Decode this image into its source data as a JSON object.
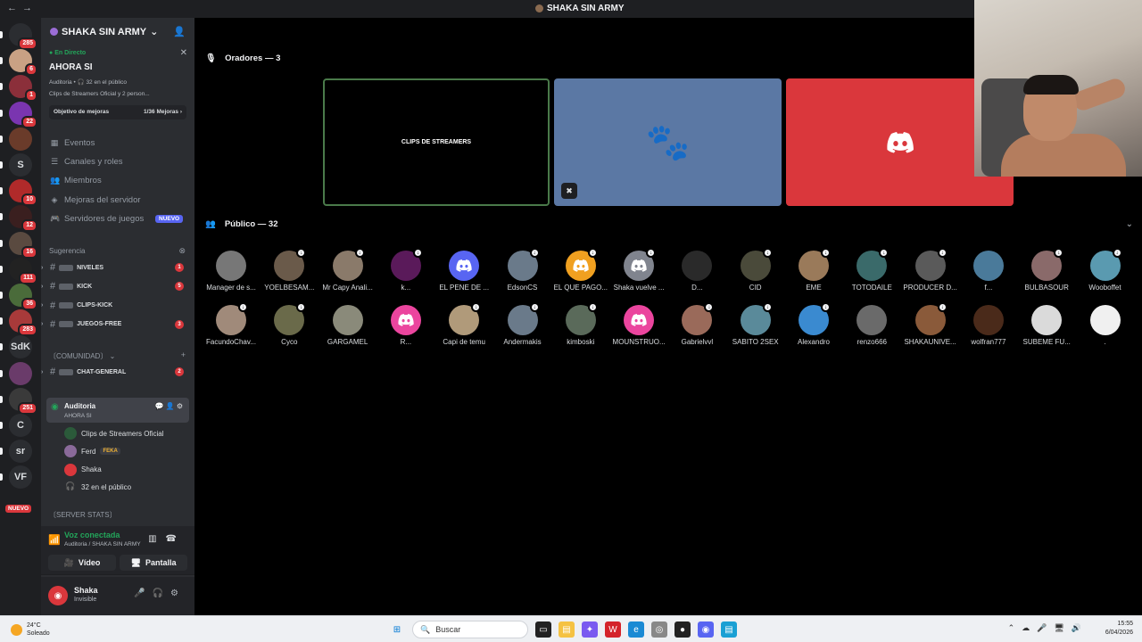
{
  "window": {
    "title": "SHAKA SIN ARMY"
  },
  "guilds": [
    {
      "label": "",
      "badge": "285",
      "color": "#2b2d31",
      "glyph": "◆"
    },
    {
      "label": "",
      "badge": "6",
      "color": "#c9a184",
      "glyph": ""
    },
    {
      "label": "",
      "badge": "1",
      "color": "#8b2f3a",
      "glyph": ""
    },
    {
      "label": "",
      "badge": "22",
      "color": "#7a35b0",
      "glyph": ""
    },
    {
      "label": "",
      "badge": "",
      "color": "#6a3b2a",
      "glyph": ""
    },
    {
      "label": "S",
      "badge": "",
      "color": "#2b2d31",
      "glyph": ""
    },
    {
      "label": "",
      "badge": "10",
      "color": "#b02a2a",
      "glyph": ""
    },
    {
      "label": "",
      "badge": "12",
      "color": "#3a1f1f",
      "glyph": ""
    },
    {
      "label": "",
      "badge": "16",
      "color": "#5a4a40",
      "glyph": ""
    },
    {
      "label": "",
      "badge": "111",
      "color": "#222",
      "glyph": ""
    },
    {
      "label": "",
      "badge": "36",
      "color": "#4a6b3a",
      "glyph": ""
    },
    {
      "label": "",
      "badge": "283",
      "color": "#a83a3a",
      "glyph": ""
    },
    {
      "label": "SdK",
      "badge": "",
      "color": "#2b2d31",
      "glyph": ""
    },
    {
      "label": "",
      "badge": "",
      "color": "#6a3b6a",
      "glyph": ""
    },
    {
      "label": "",
      "badge": "251",
      "color": "#3a3a3a",
      "glyph": ""
    },
    {
      "label": "C",
      "badge": "",
      "color": "#2b2d31",
      "glyph": ""
    },
    {
      "label": "sr",
      "badge": "",
      "color": "#2b2d31",
      "glyph": ""
    },
    {
      "label": "VF",
      "badge": "",
      "color": "#2b2d31",
      "glyph": ""
    }
  ],
  "guild_new_label": "NUEVO",
  "server": {
    "name": "SHAKA SIN ARMY"
  },
  "live": {
    "tag": "En Directo",
    "title": "AHORA SI",
    "meta": "Auditoria • 🎧 32 en el público",
    "who": "Clips de Streamers Oficial y 2 person...",
    "goal_label": "Objetivo de mejoras",
    "goal_value": "1/36 Mejoras ›"
  },
  "menu": [
    {
      "label": "Eventos",
      "icon": "calendar-icon",
      "glyph": "▦"
    },
    {
      "label": "Canales y roles",
      "icon": "channels-icon",
      "glyph": "☰"
    },
    {
      "label": "Miembros",
      "icon": "members-icon",
      "glyph": "👥"
    },
    {
      "label": "Mejoras del servidor",
      "icon": "boost-icon",
      "glyph": "◈"
    },
    {
      "label": "Servidores de juegos",
      "icon": "gamepad-icon",
      "glyph": "🎮"
    }
  ],
  "menu_new_badge": "NUEVO",
  "categories": {
    "sugerencia": "Sugerencia",
    "comunidad": "〔COMUNIDAD〕",
    "server_stats": "〔SERVER STATS〕"
  },
  "channels": [
    {
      "label": "NIVELES",
      "count": "1"
    },
    {
      "label": "KICK",
      "count": "5"
    },
    {
      "label": "CLIPS-KICK",
      "count": ""
    },
    {
      "label": "JUEGOS-FREE",
      "count": "3"
    }
  ],
  "community_channel": {
    "label": "CHAT-GENERAL",
    "count": "2"
  },
  "voice_channel": {
    "name": "Auditoria",
    "sub": "AHORA SI"
  },
  "voice_users": [
    {
      "name": "Clips de Streamers Oficial",
      "color": "#2b5a3a",
      "tag": ""
    },
    {
      "name": "Ferd",
      "color": "#8a6a9a",
      "tag": "FEKA"
    },
    {
      "name": "Shaka",
      "color": "#da373c",
      "tag": ""
    },
    {
      "name": "32 en el público",
      "color": "transparent",
      "tag": ""
    }
  ],
  "voice_panel": {
    "status": "Voz conectada",
    "sub": "Auditoria / SHAKA SIN ARMY",
    "video": "Vídeo",
    "screen": "Pantalla"
  },
  "user": {
    "name": "Shaka",
    "status": "Invisible"
  },
  "stage": {
    "speakers_title": "Oradores — 3",
    "audience_title": "Público — 32",
    "tile1_label": "CLIPS DE STREAMERS"
  },
  "audience": [
    {
      "name": "Manager de s...",
      "color": "#777",
      "dl": false,
      "glyph": ""
    },
    {
      "name": "YOELBESAM...",
      "color": "#6a5a4a",
      "dl": true,
      "glyph": ""
    },
    {
      "name": "Mr Capy Anali...",
      "color": "#8a7a6a",
      "dl": true,
      "glyph": ""
    },
    {
      "name": "k...",
      "color": "#5a1a5a",
      "dl": true,
      "glyph": ""
    },
    {
      "name": "EL PENE DE ...",
      "color": "#5865f2",
      "dl": false,
      "glyph": "discord"
    },
    {
      "name": "EdsonCS",
      "color": "#6a7a8a",
      "dl": true,
      "glyph": ""
    },
    {
      "name": "EL QUE PAGO...",
      "color": "#f0a020",
      "dl": true,
      "glyph": "discord"
    },
    {
      "name": "Shaka vuelve ...",
      "color": "#80848e",
      "dl": true,
      "glyph": "discord"
    },
    {
      "name": "D...",
      "color": "#2a2a2a",
      "dl": false,
      "glyph": ""
    },
    {
      "name": "CID",
      "color": "#4a4a3a",
      "dl": true,
      "glyph": ""
    },
    {
      "name": "EME",
      "color": "#9a7a5a",
      "dl": true,
      "glyph": ""
    },
    {
      "name": "TOTODAILE",
      "color": "#3a6a6a",
      "dl": true,
      "glyph": ""
    },
    {
      "name": "PRODUCER D...",
      "color": "#5a5a5a",
      "dl": true,
      "glyph": ""
    },
    {
      "name": "f...",
      "color": "#4a7a9a",
      "dl": false,
      "glyph": ""
    },
    {
      "name": "BULBASOUR",
      "color": "#8a6a6a",
      "dl": true,
      "glyph": ""
    },
    {
      "name": "Wooboffet",
      "color": "#5a9ab0",
      "dl": true,
      "glyph": ""
    },
    {
      "name": "FacundoChav...",
      "color": "#a08a7a",
      "dl": true,
      "glyph": ""
    },
    {
      "name": "Cyco",
      "color": "#6a6a4a",
      "dl": true,
      "glyph": ""
    },
    {
      "name": "GARGAMEL",
      "color": "#8a8a7a",
      "dl": false,
      "glyph": ""
    },
    {
      "name": "R...",
      "color": "#eb459e",
      "dl": false,
      "glyph": "discord"
    },
    {
      "name": "Capi de temu",
      "color": "#b09a7a",
      "dl": true,
      "glyph": ""
    },
    {
      "name": "Andermakis",
      "color": "#6a7a8a",
      "dl": true,
      "glyph": ""
    },
    {
      "name": "kimboski",
      "color": "#5a6a5a",
      "dl": true,
      "glyph": ""
    },
    {
      "name": "MOUNSTRUO...",
      "color": "#eb459e",
      "dl": false,
      "glyph": "discord"
    },
    {
      "name": "Gabrielvvl",
      "color": "#9a6a5a",
      "dl": true,
      "glyph": ""
    },
    {
      "name": "SABITO 2SEX",
      "color": "#5a8a9a",
      "dl": true,
      "glyph": ""
    },
    {
      "name": "Alexandro",
      "color": "#3a8ad0",
      "dl": true,
      "glyph": ""
    },
    {
      "name": "renzo666",
      "color": "#6a6a6a",
      "dl": false,
      "glyph": ""
    },
    {
      "name": "SHAKAUNIVE...",
      "color": "#8a5a3a",
      "dl": true,
      "glyph": ""
    },
    {
      "name": "wolfran777",
      "color": "#4a2a1a",
      "dl": false,
      "glyph": ""
    },
    {
      "name": "SUBEME FU...",
      "color": "#dadada",
      "dl": false,
      "glyph": ""
    },
    {
      "name": ".",
      "color": "#f0f0f0",
      "dl": false,
      "glyph": ""
    }
  ],
  "taskbar": {
    "temp": "24°C",
    "weather": "Soleado",
    "search": "Buscar",
    "time": "15:55",
    "date": "6/04/2026"
  }
}
